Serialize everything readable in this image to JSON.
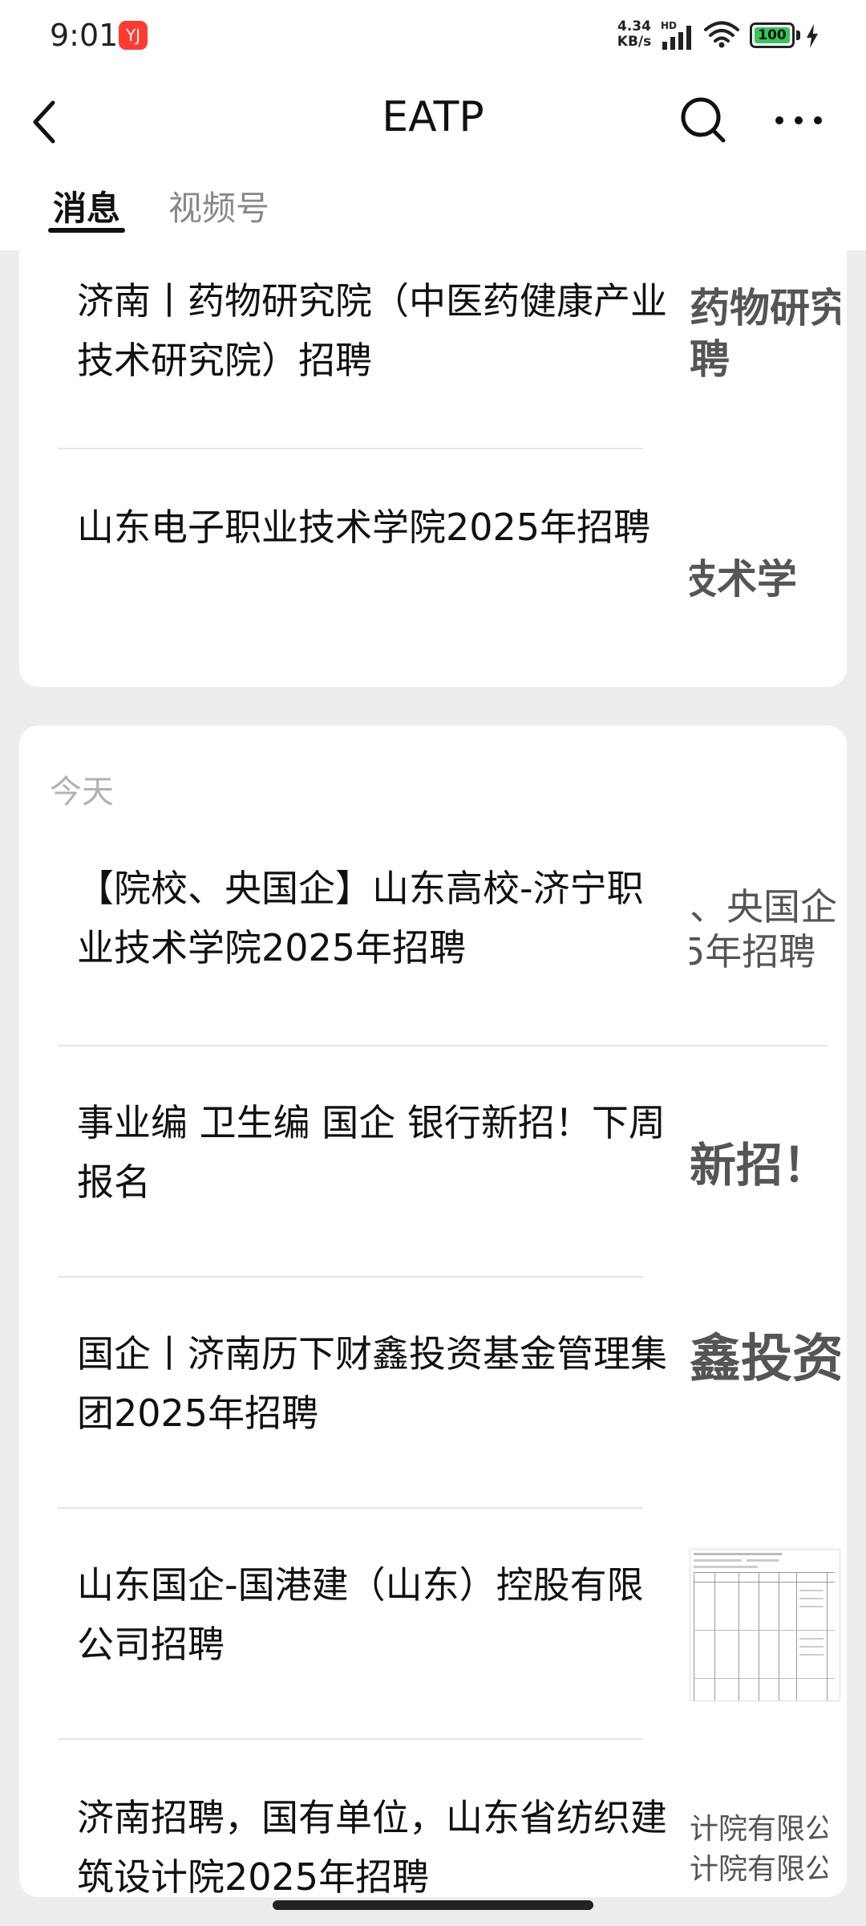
{
  "status_bar": {
    "time": "9:01",
    "app_icon_label": "YJ",
    "net_speed_value": "4.34",
    "net_speed_unit": "KB/s",
    "network_type": "HD",
    "battery_level": "100",
    "icons": [
      "app-notification-icon",
      "signal-icon",
      "wifi-icon",
      "battery-icon",
      "charging-icon"
    ]
  },
  "header": {
    "title": "EATP",
    "icons": [
      "back-arrow-icon",
      "search-icon",
      "more-dots-icon"
    ]
  },
  "tabs": [
    {
      "label": "消息",
      "active": true
    },
    {
      "label": "视频号",
      "active": false
    }
  ],
  "top_card": {
    "articles": [
      {
        "title": "济南丨药物研究院（中医药健康产业技术研究院）招聘",
        "thumb_text": [
          "药物研究",
          "聘"
        ]
      },
      {
        "title": "山东电子职业技术学院2025年招聘",
        "thumb_text": [
          "技术学"
        ]
      }
    ]
  },
  "today_card": {
    "date_label": "今天",
    "articles": [
      {
        "title": "【院校、央国企】山东高校-济宁职业技术学院2025年招聘",
        "thumb_text": [
          "、央国企",
          "5年招聘"
        ]
      },
      {
        "title": "事业编 卫生编 国企 银行新招！下周报名",
        "thumb_text": [
          "新招！"
        ]
      },
      {
        "title": "国企丨济南历下财鑫投资基金管理集团2025年招聘",
        "thumb_text": [
          "鑫投资"
        ]
      },
      {
        "title": "山东国企-国港建（山东）控股有限公司招聘",
        "thumb_text": []
      },
      {
        "title": "济南招聘，国有单位，山东省纺织建筑设计院2025年招聘",
        "thumb_text": [
          "计院有限公司",
          "计院有限公司"
        ]
      }
    ]
  },
  "colors": {
    "background": "#ededed",
    "card": "#ffffff",
    "text_primary": "#111111",
    "text_secondary": "#888888",
    "battery_green": "#35c759"
  }
}
